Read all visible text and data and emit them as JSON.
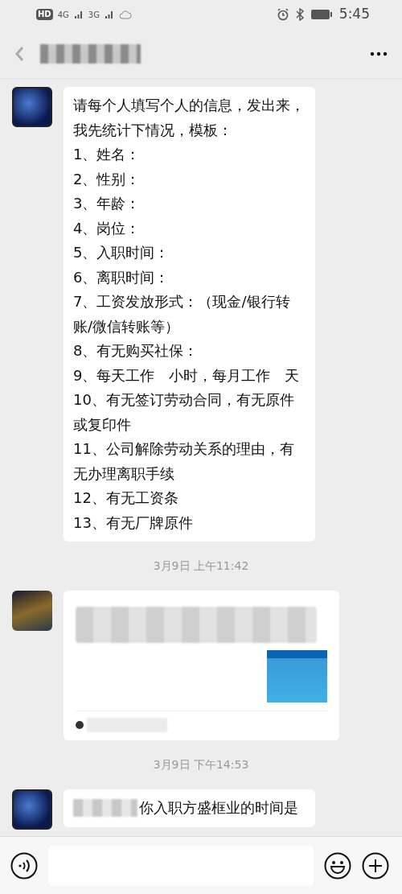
{
  "status_bar": {
    "hd": "HD",
    "network_1": "4G",
    "network_2": "3G",
    "time": "5:45"
  },
  "header": {
    "title_redacted": true
  },
  "messages": [
    {
      "kind": "text",
      "lines": [
        "请每个人填写个人的信息，发出来，我先统计下情况，模板：",
        "1、姓名：",
        "2、性别：",
        "3、年龄：",
        "4、岗位：",
        "5、入职时间：",
        "6、离职时间：",
        "7、工资发放形式：（现金/银行转账/微信转账等）",
        "8、有无购买社保：",
        "9、每天工作　小时，每月工作　天",
        "10、有无签订劳动合同，有无原件或复印件",
        "11、公司解除劳动关系的理由，有无办理离职手续",
        "12、有无工资条",
        "13、有无厂牌原件"
      ]
    },
    {
      "kind": "time",
      "text": "3月9日 上午11:42"
    },
    {
      "kind": "link"
    },
    {
      "kind": "time",
      "text": "3月9日 下午14:53"
    },
    {
      "kind": "text",
      "redacted_prefix": true,
      "lines": [
        "你入职方盛框业的时间是"
      ]
    }
  ]
}
